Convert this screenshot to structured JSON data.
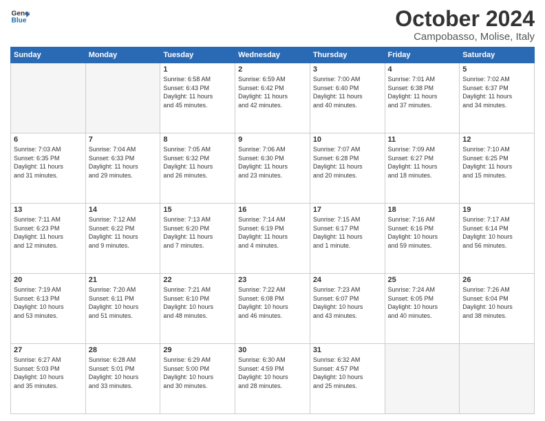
{
  "header": {
    "logo_line1": "General",
    "logo_line2": "Blue",
    "month": "October 2024",
    "location": "Campobasso, Molise, Italy"
  },
  "weekdays": [
    "Sunday",
    "Monday",
    "Tuesday",
    "Wednesday",
    "Thursday",
    "Friday",
    "Saturday"
  ],
  "weeks": [
    [
      {
        "day": "",
        "info": ""
      },
      {
        "day": "",
        "info": ""
      },
      {
        "day": "1",
        "info": "Sunrise: 6:58 AM\nSunset: 6:43 PM\nDaylight: 11 hours\nand 45 minutes."
      },
      {
        "day": "2",
        "info": "Sunrise: 6:59 AM\nSunset: 6:42 PM\nDaylight: 11 hours\nand 42 minutes."
      },
      {
        "day": "3",
        "info": "Sunrise: 7:00 AM\nSunset: 6:40 PM\nDaylight: 11 hours\nand 40 minutes."
      },
      {
        "day": "4",
        "info": "Sunrise: 7:01 AM\nSunset: 6:38 PM\nDaylight: 11 hours\nand 37 minutes."
      },
      {
        "day": "5",
        "info": "Sunrise: 7:02 AM\nSunset: 6:37 PM\nDaylight: 11 hours\nand 34 minutes."
      }
    ],
    [
      {
        "day": "6",
        "info": "Sunrise: 7:03 AM\nSunset: 6:35 PM\nDaylight: 11 hours\nand 31 minutes."
      },
      {
        "day": "7",
        "info": "Sunrise: 7:04 AM\nSunset: 6:33 PM\nDaylight: 11 hours\nand 29 minutes."
      },
      {
        "day": "8",
        "info": "Sunrise: 7:05 AM\nSunset: 6:32 PM\nDaylight: 11 hours\nand 26 minutes."
      },
      {
        "day": "9",
        "info": "Sunrise: 7:06 AM\nSunset: 6:30 PM\nDaylight: 11 hours\nand 23 minutes."
      },
      {
        "day": "10",
        "info": "Sunrise: 7:07 AM\nSunset: 6:28 PM\nDaylight: 11 hours\nand 20 minutes."
      },
      {
        "day": "11",
        "info": "Sunrise: 7:09 AM\nSunset: 6:27 PM\nDaylight: 11 hours\nand 18 minutes."
      },
      {
        "day": "12",
        "info": "Sunrise: 7:10 AM\nSunset: 6:25 PM\nDaylight: 11 hours\nand 15 minutes."
      }
    ],
    [
      {
        "day": "13",
        "info": "Sunrise: 7:11 AM\nSunset: 6:23 PM\nDaylight: 11 hours\nand 12 minutes."
      },
      {
        "day": "14",
        "info": "Sunrise: 7:12 AM\nSunset: 6:22 PM\nDaylight: 11 hours\nand 9 minutes."
      },
      {
        "day": "15",
        "info": "Sunrise: 7:13 AM\nSunset: 6:20 PM\nDaylight: 11 hours\nand 7 minutes."
      },
      {
        "day": "16",
        "info": "Sunrise: 7:14 AM\nSunset: 6:19 PM\nDaylight: 11 hours\nand 4 minutes."
      },
      {
        "day": "17",
        "info": "Sunrise: 7:15 AM\nSunset: 6:17 PM\nDaylight: 11 hours\nand 1 minute."
      },
      {
        "day": "18",
        "info": "Sunrise: 7:16 AM\nSunset: 6:16 PM\nDaylight: 10 hours\nand 59 minutes."
      },
      {
        "day": "19",
        "info": "Sunrise: 7:17 AM\nSunset: 6:14 PM\nDaylight: 10 hours\nand 56 minutes."
      }
    ],
    [
      {
        "day": "20",
        "info": "Sunrise: 7:19 AM\nSunset: 6:13 PM\nDaylight: 10 hours\nand 53 minutes."
      },
      {
        "day": "21",
        "info": "Sunrise: 7:20 AM\nSunset: 6:11 PM\nDaylight: 10 hours\nand 51 minutes."
      },
      {
        "day": "22",
        "info": "Sunrise: 7:21 AM\nSunset: 6:10 PM\nDaylight: 10 hours\nand 48 minutes."
      },
      {
        "day": "23",
        "info": "Sunrise: 7:22 AM\nSunset: 6:08 PM\nDaylight: 10 hours\nand 46 minutes."
      },
      {
        "day": "24",
        "info": "Sunrise: 7:23 AM\nSunset: 6:07 PM\nDaylight: 10 hours\nand 43 minutes."
      },
      {
        "day": "25",
        "info": "Sunrise: 7:24 AM\nSunset: 6:05 PM\nDaylight: 10 hours\nand 40 minutes."
      },
      {
        "day": "26",
        "info": "Sunrise: 7:26 AM\nSunset: 6:04 PM\nDaylight: 10 hours\nand 38 minutes."
      }
    ],
    [
      {
        "day": "27",
        "info": "Sunrise: 6:27 AM\nSunset: 5:03 PM\nDaylight: 10 hours\nand 35 minutes."
      },
      {
        "day": "28",
        "info": "Sunrise: 6:28 AM\nSunset: 5:01 PM\nDaylight: 10 hours\nand 33 minutes."
      },
      {
        "day": "29",
        "info": "Sunrise: 6:29 AM\nSunset: 5:00 PM\nDaylight: 10 hours\nand 30 minutes."
      },
      {
        "day": "30",
        "info": "Sunrise: 6:30 AM\nSunset: 4:59 PM\nDaylight: 10 hours\nand 28 minutes."
      },
      {
        "day": "31",
        "info": "Sunrise: 6:32 AM\nSunset: 4:57 PM\nDaylight: 10 hours\nand 25 minutes."
      },
      {
        "day": "",
        "info": ""
      },
      {
        "day": "",
        "info": ""
      }
    ]
  ]
}
